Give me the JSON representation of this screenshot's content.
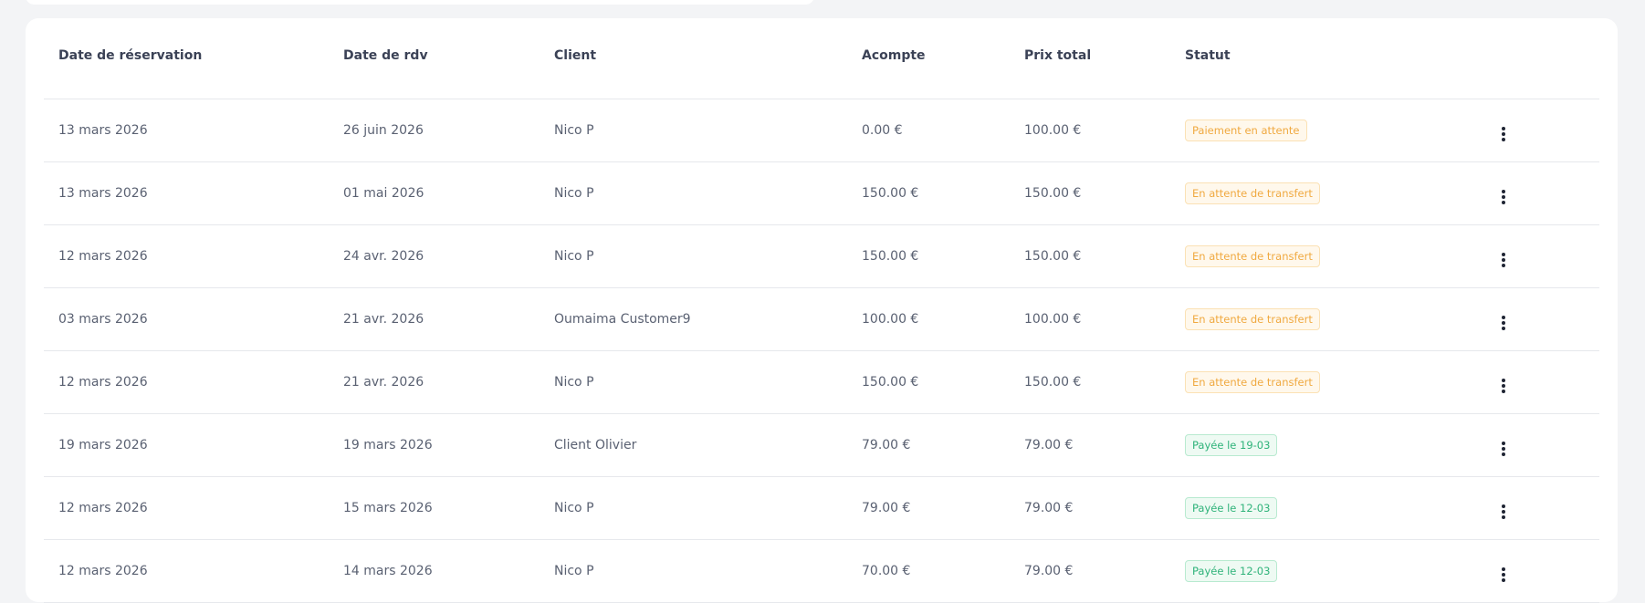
{
  "table": {
    "headers": [
      "Date de réservation",
      "Date de rdv",
      "Client",
      "Acompte",
      "Prix total",
      "Statut"
    ],
    "rows": [
      {
        "booking_date": "13 mars 2026",
        "rdv_date": "26 juin 2026",
        "client": "Nico P",
        "deposit": "0.00 €",
        "total": "100.00 €",
        "status": "Paiement en attente",
        "status_type": "warn"
      },
      {
        "booking_date": "13 mars 2026",
        "rdv_date": "01 mai 2026",
        "client": "Nico P",
        "deposit": "150.00 €",
        "total": "150.00 €",
        "status": "En attente de transfert",
        "status_type": "warn"
      },
      {
        "booking_date": "12 mars 2026",
        "rdv_date": "24 avr. 2026",
        "client": "Nico P",
        "deposit": "150.00 €",
        "total": "150.00 €",
        "status": "En attente de transfert",
        "status_type": "warn"
      },
      {
        "booking_date": "03 mars 2026",
        "rdv_date": "21 avr. 2026",
        "client": "Oumaima Customer9",
        "deposit": "100.00 €",
        "total": "100.00 €",
        "status": "En attente de transfert",
        "status_type": "warn"
      },
      {
        "booking_date": "12 mars 2026",
        "rdv_date": "21 avr. 2026",
        "client": "Nico P",
        "deposit": "150.00 €",
        "total": "150.00 €",
        "status": "En attente de transfert",
        "status_type": "warn"
      },
      {
        "booking_date": "19 mars 2026",
        "rdv_date": "19 mars 2026",
        "client": "Client Olivier",
        "deposit": "79.00 €",
        "total": "79.00 €",
        "status": "Payée le 19-03",
        "status_type": "ok"
      },
      {
        "booking_date": "12 mars 2026",
        "rdv_date": "15 mars 2026",
        "client": "Nico P",
        "deposit": "79.00 €",
        "total": "79.00 €",
        "status": "Payée le 12-03",
        "status_type": "ok"
      },
      {
        "booking_date": "12 mars 2026",
        "rdv_date": "14 mars 2026",
        "client": "Nico P",
        "deposit": "70.00 €",
        "total": "79.00 €",
        "status": "Payée le 12-03",
        "status_type": "ok"
      }
    ]
  },
  "icons": {
    "row_actions": "more-vertical-icon"
  },
  "colors": {
    "warn_text": "#f0a940",
    "ok_text": "#2fb37a",
    "background": "#f3f4f6"
  }
}
